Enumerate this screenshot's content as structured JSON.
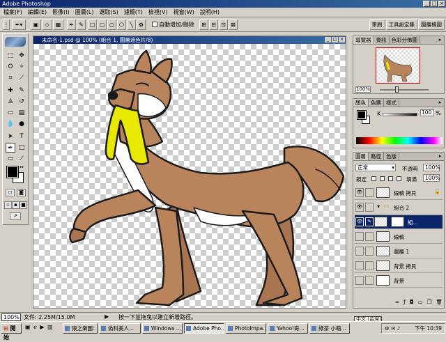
{
  "app": {
    "title": "Adobe Photoshop",
    "window_controls": [
      "_",
      "□",
      "×"
    ]
  },
  "menu": [
    "檔案(F)",
    "編輯(E)",
    "影像(I)",
    "圖層(L)",
    "選取(S)",
    "濾鏡(T)",
    "檢視(V)",
    "視窗(W)",
    "說明(H)"
  ],
  "options_bar": {
    "auto_add_delete_label": "自動增加/刪除",
    "palette_well_tabs": [
      "筆刷",
      "工具設定集",
      "圖層構圖"
    ]
  },
  "document": {
    "title": "未命名-1.psd @ 100% (組合 1, 圖層遮色片/8)",
    "zoom": "100%",
    "doc_size": "文件: 2.25M/15.0M",
    "status_hint": "按一下並拖曳以建立新增路徑。"
  },
  "navigator": {
    "tabs": [
      "導覽器",
      "資訊",
      "色彩分佈圖"
    ],
    "zoom": "100%"
  },
  "color": {
    "tabs": [
      "顏色",
      "色票",
      "樣式"
    ],
    "channel_label": "K",
    "value": "100",
    "unit": "%",
    "foreground": "#000000",
    "background": "#ffffff"
  },
  "layers": {
    "tabs": [
      "圖層",
      "路徑",
      "色版"
    ],
    "blend_mode": "正常",
    "opacity_label": "不透明",
    "opacity_value": "100%",
    "lock_label": "鎖定",
    "fill_label": "填滿",
    "fill_value": "100%",
    "items": [
      {
        "name": "線稿 拷貝",
        "visible": true,
        "selected": false,
        "type": "layer"
      },
      {
        "name": "組合 2",
        "visible": true,
        "selected": false,
        "type": "group"
      },
      {
        "name": "組...",
        "visible": true,
        "selected": true,
        "type": "layer_with_mask"
      },
      {
        "name": "線稿",
        "visible": false,
        "selected": false,
        "type": "layer"
      },
      {
        "name": "圖層 1",
        "visible": false,
        "selected": false,
        "type": "layer"
      },
      {
        "name": "背景 拷貝",
        "visible": false,
        "selected": false,
        "type": "layer"
      },
      {
        "name": "背景",
        "visible": false,
        "selected": false,
        "type": "background"
      }
    ]
  },
  "taskbar": {
    "start_label": "開始",
    "buttons": [
      "狼之樂園：...",
      "偽科美人...",
      "Windows ...",
      "Adobe Pho...",
      "PhotoImpa...",
      "Yahoo!奇...",
      "綠茶 小萌..."
    ],
    "active_index": 3,
    "ime_label": "中文 (台灣)",
    "clock": "下午 10:39"
  },
  "colors": {
    "wolf_fur": "#b9845c",
    "wolf_white": "#ffffff",
    "towel": "#e8e800",
    "titlebar": "#0a246a"
  }
}
